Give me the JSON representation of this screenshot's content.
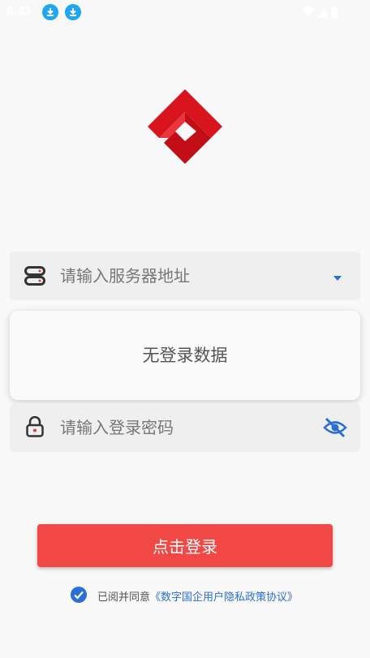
{
  "status_bar": {
    "time": "8:43",
    "icons": [
      "download-icon",
      "download-icon",
      "wifi-icon",
      "signal-icon",
      "battery-icon"
    ]
  },
  "logo": {
    "name": "app-logo",
    "color": "#d8141c"
  },
  "server": {
    "placeholder": "请输入服务器地址",
    "icon": "server-icon",
    "dropdown_icon": "caret-down-icon",
    "accent": "#2a6fd6"
  },
  "login_list": {
    "empty_text": "无登录数据"
  },
  "password": {
    "placeholder": "请输入登录密码",
    "icon": "lock-icon",
    "toggle_icon": "eye-off-icon"
  },
  "login_button": {
    "label": "点击登录",
    "color": "#f24845"
  },
  "agreement": {
    "checked": true,
    "prefix": "已阅并同意",
    "link": "《数字国企用户隐私政策协议》"
  }
}
